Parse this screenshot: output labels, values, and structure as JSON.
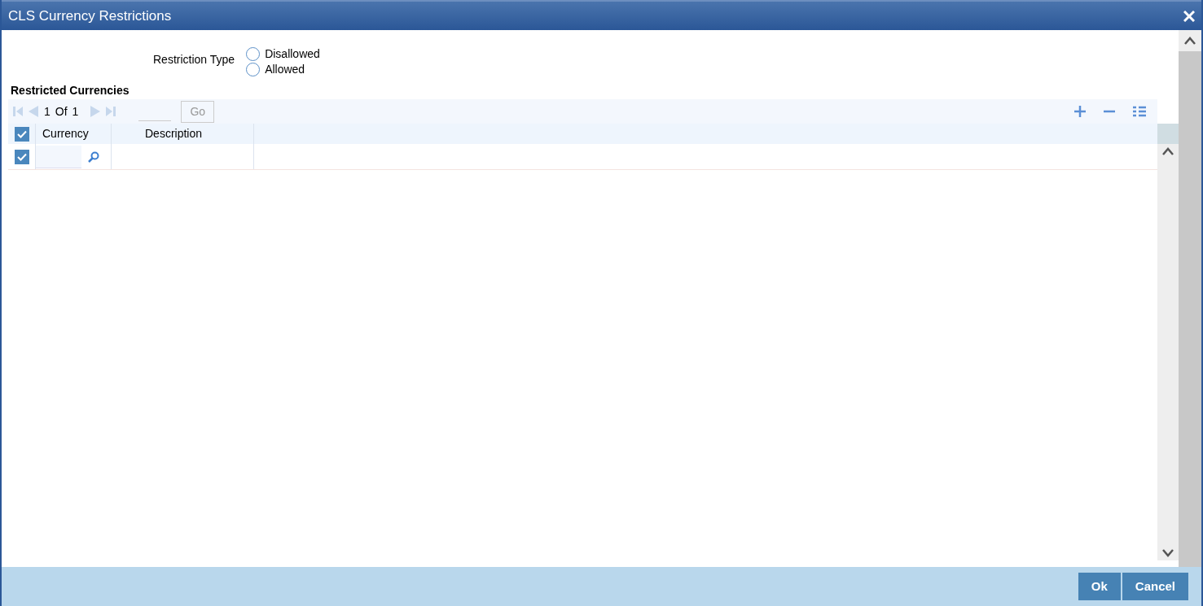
{
  "window": {
    "title": "CLS Currency Restrictions"
  },
  "restriction_type": {
    "label": "Restriction Type",
    "options": [
      {
        "label": "Disallowed",
        "selected": false
      },
      {
        "label": "Allowed",
        "selected": false
      }
    ]
  },
  "section_title": "Restricted Currencies",
  "pager": {
    "current": "1",
    "of": "Of",
    "total": "1",
    "go": {
      "label": "Go",
      "disabled": true
    }
  },
  "table": {
    "select_all": {
      "checked": true
    },
    "columns": [
      "Currency",
      "Description"
    ],
    "rows": [
      {
        "checked": true
      }
    ]
  },
  "buttons": [
    "Ok",
    "Cancel"
  ]
}
